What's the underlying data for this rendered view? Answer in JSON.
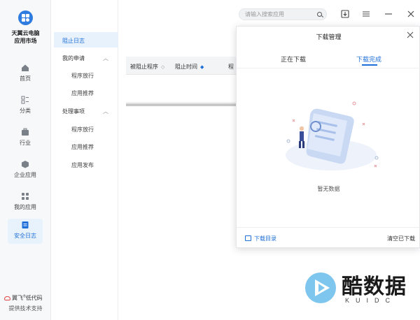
{
  "app": {
    "brand_title": "天翼云电脑\n应用市场",
    "footer_brand": "翼飞",
    "footer_brand_suffix": "低代码",
    "footer_sub": "提供技术支持"
  },
  "rail": {
    "items": [
      {
        "label": "首页",
        "icon": "home-icon"
      },
      {
        "label": "分类",
        "icon": "category-icon"
      },
      {
        "label": "行业",
        "icon": "briefcase-icon"
      },
      {
        "label": "企业应用",
        "icon": "cube-icon"
      },
      {
        "label": "我的应用",
        "icon": "apps-grid-icon"
      },
      {
        "label": "安全日志",
        "icon": "log-icon",
        "active": true
      }
    ]
  },
  "subnav": {
    "selected": "阻止日志",
    "groups": [
      {
        "label": "我的申请",
        "chevron": "︿",
        "items": [
          "程序放行",
          "应用推荐"
        ]
      },
      {
        "label": "处理事项",
        "chevron": "︿",
        "items": [
          "程序放行",
          "应用推荐",
          "应用发布"
        ]
      }
    ]
  },
  "table": {
    "columns": [
      "被阻止程序",
      "阻止时间",
      "程"
    ],
    "sort_glyph": "◇",
    "sort_active_glyph": "◆"
  },
  "search": {
    "placeholder": "请输入搜索应用"
  },
  "download_panel": {
    "title": "下载管理",
    "tabs": [
      "正在下载",
      "下载完成"
    ],
    "active_tab": 1,
    "empty_text": "暂无数据",
    "dir_label": "下载目录",
    "clear_label": "清空已下载"
  },
  "watermark": {
    "text": "酷数据",
    "sub": "KUIDC"
  },
  "colors": {
    "accent": "#1e6fd9",
    "active_bg": "#e8f2fd"
  }
}
